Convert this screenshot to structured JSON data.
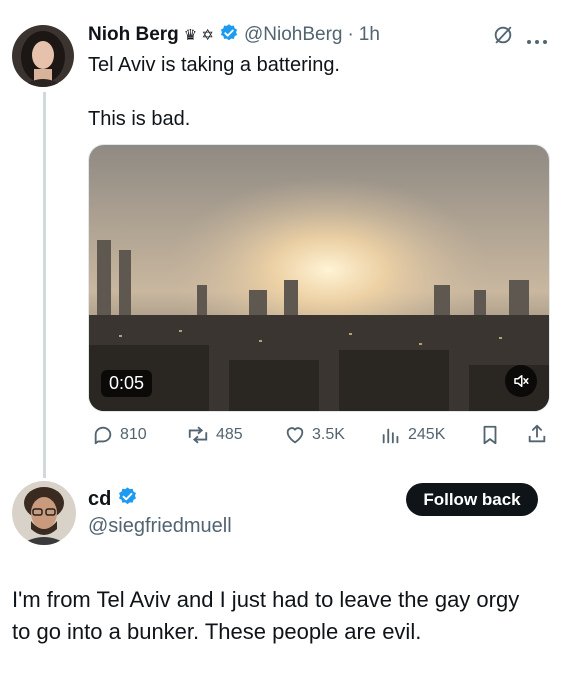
{
  "post": {
    "author_name": "Nioh Berg",
    "name_emojis": "♛ ✡",
    "handle": "@NiohBerg",
    "separator": "·",
    "time": "1h",
    "text_line1": "Tel Aviv is taking a battering.",
    "text_line2": "This is bad.",
    "video_duration": "0:05",
    "stats": {
      "replies": "810",
      "reposts": "485",
      "likes": "3.5K",
      "views": "245K"
    }
  },
  "reply": {
    "author_name": "cd",
    "handle": "@siegfriedmuell",
    "follow_label": "Follow back",
    "text": "I'm from Tel Aviv and I just had to leave the gay orgy to go into a bunker.  These people are evil."
  },
  "colors": {
    "verified": "#1d9bf0",
    "muted": "#536471",
    "thread_line": "#cfd9de"
  },
  "icons": [
    "grok-icon",
    "more-icon",
    "verified-icon",
    "reply-icon",
    "repost-icon",
    "like-icon",
    "views-icon",
    "bookmark-icon",
    "share-icon",
    "mute-icon"
  ]
}
